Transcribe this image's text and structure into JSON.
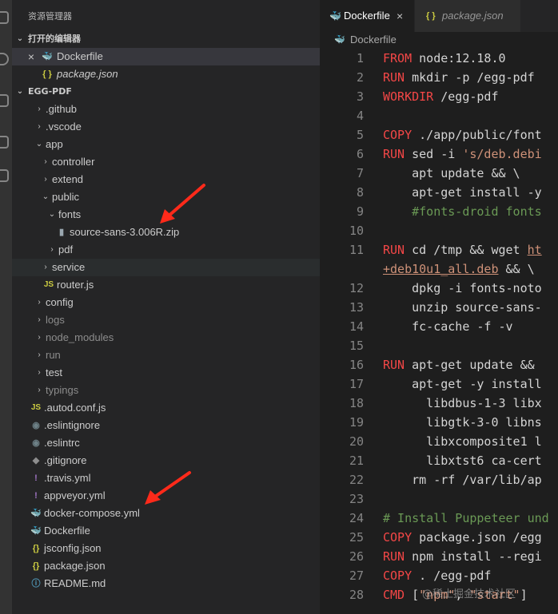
{
  "sidebar": {
    "title": "资源管理器",
    "open_editors": {
      "header": "打开的编辑器",
      "items": [
        {
          "name": "Dockerfile",
          "icon": "docker-icon",
          "close": "×"
        },
        {
          "name": "package.json",
          "icon": "json-icon",
          "glyph": "{ }"
        }
      ]
    },
    "project": {
      "header": "EGG-PDF",
      "tree": [
        {
          "name": ".github",
          "chev": "›",
          "icon": "chevron-right-icon"
        },
        {
          "name": ".vscode",
          "chev": "›",
          "icon": "chevron-right-icon"
        },
        {
          "name": "app",
          "chev": "⌄",
          "icon": "chevron-down-icon"
        },
        {
          "name": "controller",
          "chev": "›",
          "icon": "chevron-right-icon"
        },
        {
          "name": "extend",
          "chev": "›",
          "icon": "chevron-right-icon"
        },
        {
          "name": "public",
          "chev": "⌄",
          "icon": "chevron-down-icon"
        },
        {
          "name": "fonts",
          "chev": "⌄",
          "icon": "chevron-down-icon"
        },
        {
          "name": "source-sans-3.006R.zip",
          "glyph": "▮",
          "icon": "zip-icon"
        },
        {
          "name": "pdf",
          "chev": "›",
          "icon": "chevron-right-icon"
        },
        {
          "name": "service",
          "chev": "›",
          "icon": "chevron-right-icon"
        },
        {
          "name": "router.js",
          "glyph": "JS",
          "icon": "js-icon"
        },
        {
          "name": "config",
          "chev": "›",
          "icon": "chevron-right-icon"
        },
        {
          "name": "logs",
          "chev": "›",
          "icon": "chevron-right-icon"
        },
        {
          "name": "node_modules",
          "chev": "›",
          "icon": "chevron-right-icon"
        },
        {
          "name": "run",
          "chev": "›",
          "icon": "chevron-right-icon"
        },
        {
          "name": "test",
          "chev": "›",
          "icon": "chevron-right-icon"
        },
        {
          "name": "typings",
          "chev": "›",
          "icon": "chevron-right-icon"
        },
        {
          "name": ".autod.conf.js",
          "glyph": "JS",
          "icon": "js-icon"
        },
        {
          "name": ".eslintignore",
          "glyph": "◉",
          "icon": "eslint-icon"
        },
        {
          "name": ".eslintrc",
          "glyph": "◉",
          "icon": "eslint-icon"
        },
        {
          "name": ".gitignore",
          "glyph": "◆",
          "icon": "git-icon"
        },
        {
          "name": ".travis.yml",
          "glyph": "!",
          "icon": "yaml-icon"
        },
        {
          "name": "appveyor.yml",
          "glyph": "!",
          "icon": "yaml-icon"
        },
        {
          "name": "docker-compose.yml",
          "glyph": "🐳",
          "icon": "docker-compose-icon"
        },
        {
          "name": "Dockerfile",
          "glyph": "🐳",
          "icon": "docker-icon"
        },
        {
          "name": "jsconfig.json",
          "glyph": "{}",
          "icon": "json-icon"
        },
        {
          "name": "package.json",
          "glyph": "{}",
          "icon": "json-icon"
        },
        {
          "name": "README.md",
          "glyph": "ⓘ",
          "icon": "info-icon"
        }
      ]
    }
  },
  "editor": {
    "tabs": [
      {
        "label": "Dockerfile",
        "close": "×",
        "glyph": "🐳"
      },
      {
        "label": "package.json",
        "glyph": "{ }"
      }
    ],
    "breadcrumb": "Dockerfile",
    "lines": [
      {
        "n": "1",
        "tokens": [
          {
            "t": "FROM",
            "c": "kw"
          },
          {
            "t": " node:12.18.0"
          }
        ]
      },
      {
        "n": "2",
        "tokens": [
          {
            "t": "RUN",
            "c": "kw"
          },
          {
            "t": " mkdir -p /egg-pdf"
          }
        ]
      },
      {
        "n": "3",
        "tokens": [
          {
            "t": "WORKDIR",
            "c": "kw"
          },
          {
            "t": " /egg-pdf"
          }
        ]
      },
      {
        "n": "4",
        "tokens": []
      },
      {
        "n": "5",
        "tokens": [
          {
            "t": "COPY",
            "c": "kw"
          },
          {
            "t": " ./app/public/font"
          }
        ]
      },
      {
        "n": "6",
        "tokens": [
          {
            "t": "RUN",
            "c": "kw"
          },
          {
            "t": " sed -i "
          },
          {
            "t": "'s/deb.debi",
            "c": "str"
          }
        ]
      },
      {
        "n": "7",
        "tokens": [
          {
            "t": "    apt update && \\"
          }
        ]
      },
      {
        "n": "8",
        "tokens": [
          {
            "t": "    apt-get install -y"
          }
        ]
      },
      {
        "n": "9",
        "tokens": [
          {
            "t": "    #fonts-droid fonts",
            "c": "com"
          }
        ]
      },
      {
        "n": "10",
        "tokens": []
      },
      {
        "n": "11",
        "tokens": [
          {
            "t": "RUN",
            "c": "kw"
          },
          {
            "t": " cd /tmp && wget "
          },
          {
            "t": "ht",
            "c": "url"
          }
        ]
      },
      {
        "n": "",
        "tokens": [
          {
            "t": "+deb10u1_all.deb",
            "c": "url"
          },
          {
            "t": " && \\"
          }
        ]
      },
      {
        "n": "12",
        "tokens": [
          {
            "t": "    dpkg -i fonts-noto"
          }
        ]
      },
      {
        "n": "13",
        "tokens": [
          {
            "t": "    unzip source-sans-"
          }
        ]
      },
      {
        "n": "14",
        "tokens": [
          {
            "t": "    fc-cache -f -v"
          }
        ]
      },
      {
        "n": "15",
        "tokens": []
      },
      {
        "n": "16",
        "tokens": [
          {
            "t": "RUN",
            "c": "kw"
          },
          {
            "t": " apt-get update &&"
          }
        ]
      },
      {
        "n": "17",
        "tokens": [
          {
            "t": "    apt-get -y install"
          }
        ]
      },
      {
        "n": "18",
        "tokens": [
          {
            "t": "      libdbus-1-3 libx"
          }
        ]
      },
      {
        "n": "19",
        "tokens": [
          {
            "t": "      libgtk-3-0 libns"
          }
        ]
      },
      {
        "n": "20",
        "tokens": [
          {
            "t": "      libxcomposite1 l"
          }
        ]
      },
      {
        "n": "21",
        "tokens": [
          {
            "t": "      libxtst6 ca-cert"
          }
        ]
      },
      {
        "n": "22",
        "tokens": [
          {
            "t": "    rm -rf /var/lib/ap"
          }
        ]
      },
      {
        "n": "23",
        "tokens": []
      },
      {
        "n": "24",
        "tokens": [
          {
            "t": "# Install Puppeteer und",
            "c": "com"
          }
        ]
      },
      {
        "n": "25",
        "tokens": [
          {
            "t": "COPY",
            "c": "kw"
          },
          {
            "t": " package.json /egg"
          }
        ]
      },
      {
        "n": "26",
        "tokens": [
          {
            "t": "RUN",
            "c": "kw"
          },
          {
            "t": " npm install --regi"
          }
        ]
      },
      {
        "n": "27",
        "tokens": [
          {
            "t": "COPY",
            "c": "kw"
          },
          {
            "t": " . /egg-pdf"
          }
        ]
      },
      {
        "n": "28",
        "tokens": [
          {
            "t": "CMD",
            "c": "kw"
          },
          {
            "t": " [",
            "c": "arr"
          },
          {
            "t": "\"npm\"",
            "c": "str"
          },
          {
            "t": ", ",
            "c": "arr"
          },
          {
            "t": "\"start\"",
            "c": "str"
          },
          {
            "t": "]",
            "c": "arr"
          }
        ]
      }
    ]
  },
  "watermark": "@稀土掘金技术社区",
  "colors": {
    "keyword": "#f44747",
    "string": "#ce9178",
    "comment": "#6a9955",
    "annotation_arrow": "#ff2a1a"
  }
}
